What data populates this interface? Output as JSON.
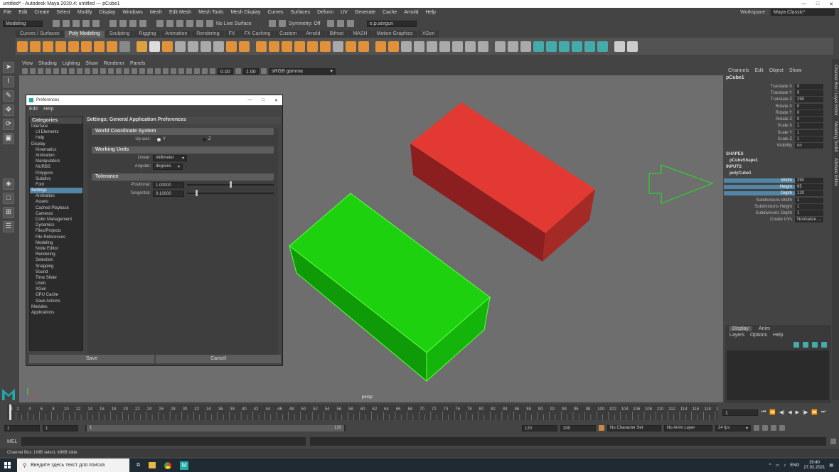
{
  "window": {
    "title": "untitled* - Autodesk Maya 2020.4: untitled   ---   pCube1",
    "controls": [
      "—",
      "□",
      "✕"
    ]
  },
  "menu": {
    "items": [
      "File",
      "Edit",
      "Create",
      "Select",
      "Modify",
      "Display",
      "Windows",
      "Mesh",
      "Edit Mesh",
      "Mesh Tools",
      "Mesh Display",
      "Curves",
      "Surfaces",
      "Deform",
      "UV",
      "Generate",
      "Cache",
      "Arnold",
      "Help"
    ],
    "workspace_label": "Workspace :",
    "workspace_value": "Maya Classic*"
  },
  "status": {
    "mode": "Modeling",
    "live_surface": "No Live Surface",
    "symmetry": "Symmetry: Off",
    "user": "e.p.sergun"
  },
  "shelf": {
    "tabs": [
      "Curves / Surfaces",
      "Poly Modeling",
      "Sculpting",
      "Rigging",
      "Animation",
      "Rendering",
      "FX",
      "FX Caching",
      "Custom",
      "Arnold",
      "Bifrost",
      "MASH",
      "Motion Graphics",
      "XGen"
    ],
    "active": "Poly Modeling"
  },
  "panel": {
    "menus": [
      "View",
      "Shading",
      "Lighting",
      "Show",
      "Renderer",
      "Panels"
    ],
    "exposure": "0.00",
    "gamma": "1.00",
    "colorspace": "sRGB gamma",
    "camera_label": "persp"
  },
  "prefs": {
    "title": "Preferences",
    "menus": [
      "Edit",
      "Help"
    ],
    "categories_header": "Categories",
    "settings_header": "Settings: General Application Preferences",
    "categories": [
      {
        "label": "Interface",
        "level": 0
      },
      {
        "label": "UI Elements",
        "level": 1
      },
      {
        "label": "Help",
        "level": 1
      },
      {
        "label": "Display",
        "level": 0
      },
      {
        "label": "Kinematics",
        "level": 1
      },
      {
        "label": "Animation",
        "level": 1
      },
      {
        "label": "Manipulators",
        "level": 1
      },
      {
        "label": "NURBS",
        "level": 1
      },
      {
        "label": "Polygons",
        "level": 1
      },
      {
        "label": "Subdivs",
        "level": 1
      },
      {
        "label": "Font",
        "level": 1
      },
      {
        "label": "Settings",
        "level": 0
      },
      {
        "label": "Animation",
        "level": 1
      },
      {
        "label": "Assets",
        "level": 1
      },
      {
        "label": "Cached Playback",
        "level": 1
      },
      {
        "label": "Cameras",
        "level": 1
      },
      {
        "label": "Color Management",
        "level": 1
      },
      {
        "label": "Dynamics",
        "level": 1
      },
      {
        "label": "Files/Projects",
        "level": 1
      },
      {
        "label": "File References",
        "level": 1
      },
      {
        "label": "Modeling",
        "level": 1
      },
      {
        "label": "Node Editor",
        "level": 1
      },
      {
        "label": "Rendering",
        "level": 1
      },
      {
        "label": "Selection",
        "level": 1
      },
      {
        "label": "Snapping",
        "level": 1
      },
      {
        "label": "Sound",
        "level": 1
      },
      {
        "label": "Time Slider",
        "level": 1
      },
      {
        "label": "Undo",
        "level": 1
      },
      {
        "label": "XGen",
        "level": 1
      },
      {
        "label": "GPU Cache",
        "level": 1
      },
      {
        "label": "Save Actions",
        "level": 1
      },
      {
        "label": "Modules",
        "level": 0
      },
      {
        "label": "Applications",
        "level": 0
      }
    ],
    "selected_category": "Settings",
    "world": {
      "header": "World Coordinate System",
      "up_label": "Up axis:",
      "up_options": [
        "Y",
        "Z"
      ],
      "up_selected": "Y"
    },
    "units": {
      "header": "Working Units",
      "linear_label": "Linear:",
      "linear": "millimeter",
      "angular_label": "Angular:",
      "angular": "degrees"
    },
    "tolerance": {
      "header": "Tolerance",
      "positional_label": "Positional:",
      "positional": "1.00000",
      "tangential_label": "Tangential:",
      "tangential": "0.10000",
      "positional_level": 0.5,
      "tangential_level": 0.1
    },
    "save": "Save",
    "cancel": "Cancel"
  },
  "channels": {
    "menus": [
      "Channels",
      "Edit",
      "Object",
      "Show"
    ],
    "object": "pCube1",
    "attrs": [
      {
        "k": "Translate X",
        "v": "0"
      },
      {
        "k": "Translate Y",
        "v": "0"
      },
      {
        "k": "Translate Z",
        "v": "250"
      },
      {
        "k": "Rotate X",
        "v": "0"
      },
      {
        "k": "Rotate Y",
        "v": "0"
      },
      {
        "k": "Rotate Z",
        "v": "0"
      },
      {
        "k": "Scale X",
        "v": "1"
      },
      {
        "k": "Scale Y",
        "v": "1"
      },
      {
        "k": "Scale Z",
        "v": "1"
      },
      {
        "k": "Visibility",
        "v": "on"
      }
    ],
    "shapes_label": "SHAPES",
    "shape": "pCubeShape1",
    "inputs_label": "INPUTS",
    "input": "polyCube1",
    "inputs": [
      {
        "k": "Width",
        "v": "250",
        "hl": true
      },
      {
        "k": "Height",
        "v": "65",
        "hl": true
      },
      {
        "k": "Depth",
        "v": "120",
        "hl": true
      },
      {
        "k": "Subdivisions Width",
        "v": "1"
      },
      {
        "k": "Subdivisions Height",
        "v": "1"
      },
      {
        "k": "Subdivisions Depth",
        "v": "1"
      },
      {
        "k": "Create UVs",
        "v": "Normalize ..."
      }
    ]
  },
  "layers": {
    "tabs": [
      "Display",
      "Anim"
    ],
    "menus": [
      "Layers",
      "Options",
      "Help"
    ]
  },
  "side_tabs": [
    "Channel Box / Layer Editor",
    "Modeling Toolkit",
    "Attribute Editor"
  ],
  "timeline": {
    "ticks": [
      "1",
      "2",
      "4",
      "6",
      "8",
      "10",
      "12",
      "14",
      "16",
      "18",
      "20",
      "22",
      "24",
      "26",
      "28",
      "30",
      "32",
      "34",
      "36",
      "38",
      "40",
      "42",
      "44",
      "46",
      "48",
      "50",
      "52",
      "54",
      "56",
      "58",
      "60",
      "62",
      "64",
      "66",
      "68",
      "70",
      "72",
      "74",
      "76",
      "78",
      "80",
      "82",
      "84",
      "86",
      "88",
      "90",
      "92",
      "94",
      "96",
      "98",
      "100",
      "102",
      "104",
      "106",
      "108",
      "110",
      "112",
      "114",
      "116",
      "118",
      "120"
    ],
    "current": "1"
  },
  "range": {
    "start": "1",
    "start2": "1",
    "slider_start": "1",
    "slider_end": "120",
    "end": "120",
    "end2": "200",
    "character": "No Character Set",
    "anim_layer": "No Anim Layer",
    "fps": "24 fps"
  },
  "mel": {
    "label": "MEL"
  },
  "help_line": "Channel Box: LMB select, MMB slide",
  "taskbar": {
    "search": "Введите здесь текст для поиска",
    "lang": "ENG",
    "time": "19:40",
    "date": "27.02.2021"
  }
}
